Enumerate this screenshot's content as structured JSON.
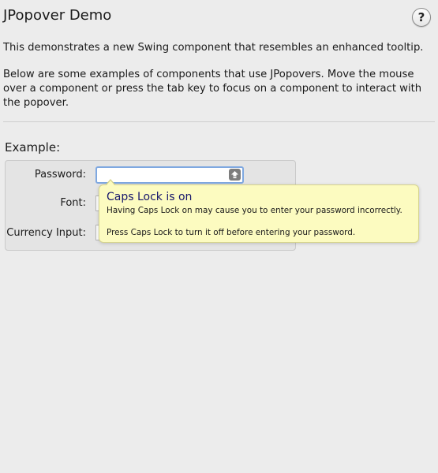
{
  "window": {
    "title": "JPopover Demo",
    "help_label": "?"
  },
  "description": {
    "line1": "This demonstrates a new Swing component that resembles an enhanced tooltip.",
    "line2": "Below are some examples of components that use JPopovers. Move the mouse over a component or press the tab key to focus on a component to interact with the popover."
  },
  "example": {
    "heading": "Example:",
    "fields": {
      "password_label": "Password:",
      "password_value": "",
      "font_label": "Font:",
      "currency_label": "Currency Input:"
    }
  },
  "popover": {
    "title": "Caps Lock is on",
    "line1": "Having Caps Lock on may cause you to enter your password incorrectly.",
    "line2": "Press Caps Lock to turn it off before entering your password."
  },
  "icons": {
    "help": "question-mark-icon",
    "caps_lock": "caps-lock-icon"
  },
  "colors": {
    "background": "#ececec",
    "popover_bg": "#fcfbc0",
    "popover_title": "#16166b",
    "focus_ring": "#7fa8e0"
  }
}
